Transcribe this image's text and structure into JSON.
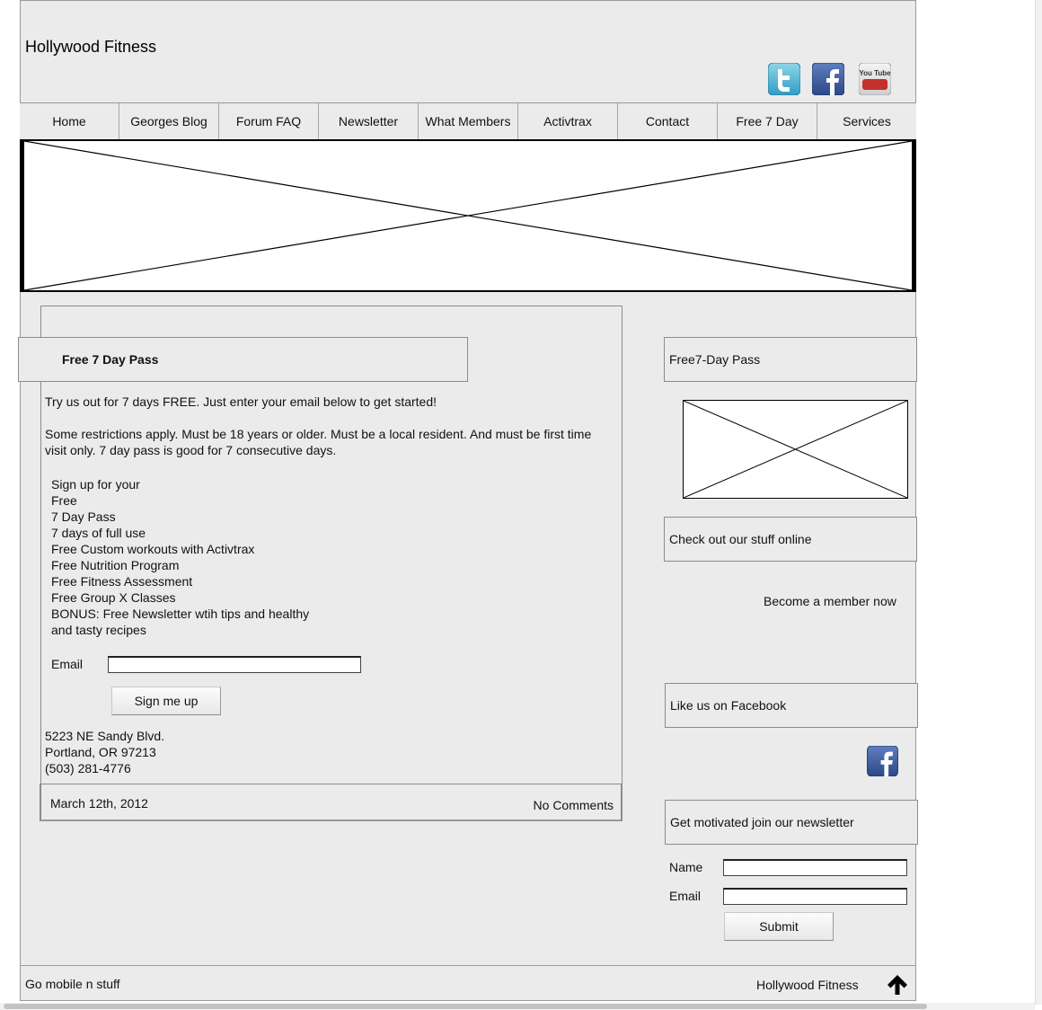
{
  "header": {
    "site_title": "Hollywood Fitness",
    "social_icons": [
      "twitter-icon",
      "facebook-icon",
      "youtube-icon"
    ],
    "youtube_label": "You Tube"
  },
  "nav": {
    "items": [
      "Home",
      "Georges Blog",
      "Forum FAQ",
      "Newsletter",
      "What Members",
      "Activtrax",
      "Contact",
      "Free 7 Day",
      "Services"
    ]
  },
  "post": {
    "title": "Free 7 Day Pass",
    "intro": "Try us out for 7 days FREE. Just enter your email below to get started!",
    "restrictions": "Some restrictions apply. Must be 18 years or older. Must be a local resident. And must be first time visit only. 7 day pass is good for 7 consecutive days.",
    "signup_lines": [
      "Sign up for your",
      "Free",
      "7 Day Pass",
      "7 days of full use",
      "Free Custom workouts with Activtrax",
      "Free Nutrition Program",
      "Free Fitness Assessment",
      "Free Group X Classes",
      "BONUS: Free Newsletter wtih tips and healthy",
      "and tasty recipes"
    ],
    "email_label": "Email",
    "email_value": "",
    "signup_button": "Sign me up",
    "address_lines": [
      "5223 NE Sandy Blvd.",
      "Portland, OR 97213",
      "(503) 281-4776"
    ],
    "date": "March 12th, 2012",
    "comments": "No Comments"
  },
  "sidebar": {
    "pass_heading": "Free7-Day Pass",
    "online_heading": "Check out our stuff online",
    "member_text": "Become a member now",
    "facebook_heading": "Like us on Facebook",
    "newsletter_heading": "Get motivated join our newsletter",
    "name_label": "Name",
    "email_label": "Email",
    "name_value": "",
    "email_value": "",
    "submit_button": "Submit"
  },
  "footer": {
    "left_text": "Go mobile n stuff",
    "right_text": "Hollywood Fitness",
    "icon": "arrow-up-icon"
  }
}
